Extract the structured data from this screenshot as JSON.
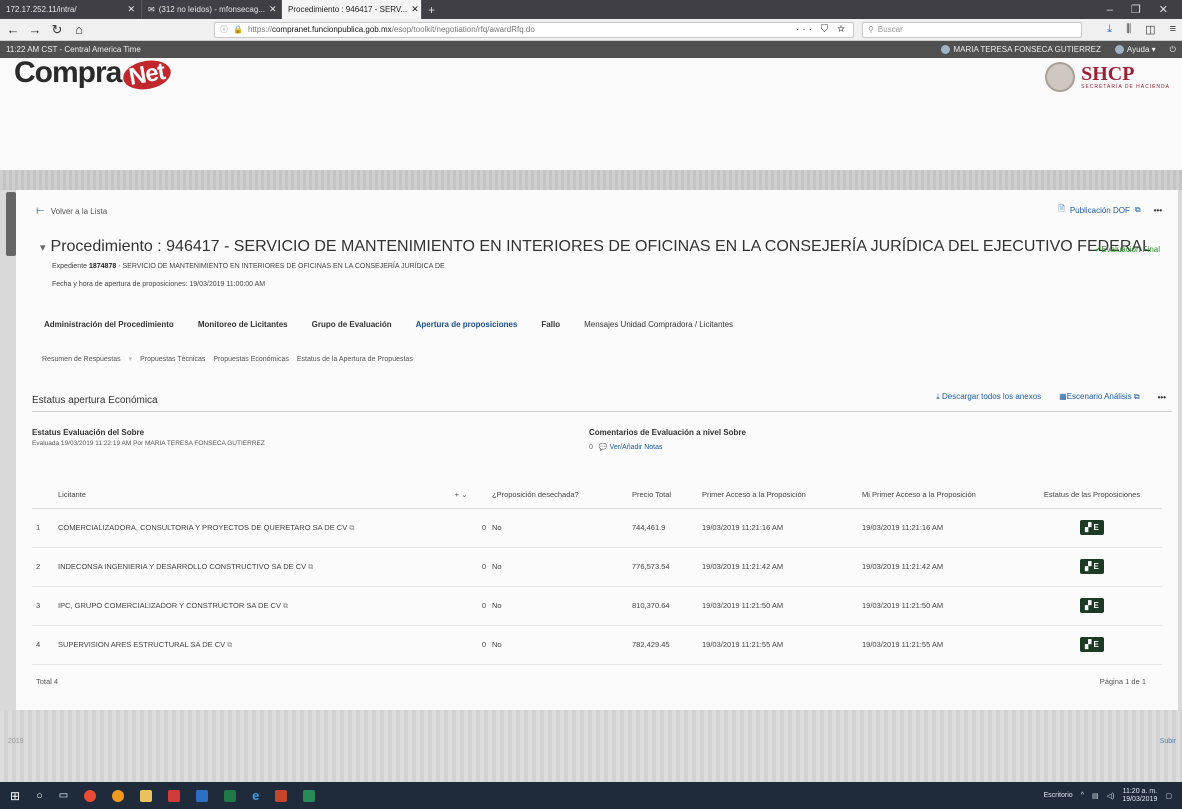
{
  "browser": {
    "tabs": [
      {
        "label": "172.17.252.11/intra/",
        "active": false
      },
      {
        "label": "(312 no leídos) - mfonsecag...",
        "active": false
      },
      {
        "label": "Procedimiento : 946417 - SERV...",
        "active": true
      }
    ],
    "url_scheme": "https://",
    "url_host": "compranet.funcionpublica.gob.mx",
    "url_path": "/esop/toolkit/negotiation/rfq/awardRfq.do",
    "search_placeholder": "Buscar"
  },
  "appbar": {
    "timezone": "11:22 AM CST - Central America Time",
    "user": "MARIA TERESA FONSECA GUTIERREZ",
    "help": "Ayuda"
  },
  "brand": {
    "logo_part1": "Compra",
    "logo_part2": "Net",
    "agency": "SHCP",
    "agency_sub": "SECRETARÍA DE HACIENDA"
  },
  "page": {
    "back_label": "Volver a la Lista",
    "dof_label": "Publicación DOF",
    "title": "Procedimiento : 946417 - SERVICIO DE MANTENIMIENTO EN INTERIORES DE OFICINAS EN LA CONSEJERÍA JURÍDICA DEL EJECUTIVO FEDERAL",
    "status": "Evaluación Final",
    "expediente_label": "Expediente",
    "expediente_num": "1874878",
    "expediente_desc": "- SERVICIO DE MANTENIMIENTO EN INTERIORES DE OFICINAS EN LA CONSEJERÍA JURÍDICA DE",
    "fecha": "Fecha y hora de apertura de proposiciones: 19/03/2019 11:00:00 AM"
  },
  "tabs": [
    {
      "label": "Administración del Procedimiento",
      "selected": false
    },
    {
      "label": "Monitoreo de Licitantes",
      "selected": false
    },
    {
      "label": "Grupo de Evaluación",
      "selected": false
    },
    {
      "label": "Apertura de proposiciones",
      "selected": true
    },
    {
      "label": "Fallo",
      "selected": false
    },
    {
      "label": "Mensajes Unidad Compradora / Licitantes",
      "selected": false
    }
  ],
  "subtabs": [
    {
      "label": "Resumen de Respuestas"
    },
    {
      "label": "Propuestas Técnicas"
    },
    {
      "label": "Propuestas Económicas"
    },
    {
      "label": "Estatus de la Apertura de Propuestas"
    }
  ],
  "section": {
    "title": "Estatus apertura Económica",
    "download_label": "Descargar todos los anexos",
    "analysis_label": "Escenario Análisis"
  },
  "evaluation": {
    "heading": "Estatus Evaluación del Sobre",
    "detail": "Evaluada 19/03/2019 11:22:19 AM Por MARIA TERESA FONSECA GUTIERREZ",
    "comments_heading": "Comentarios de Evaluación a nivel Sobre",
    "notes_count": "0",
    "notes_label": "Ver/Añadir Notas"
  },
  "table": {
    "headers": {
      "licitante": "Licitante",
      "rejected": "¿Proposición desechada?",
      "price": "Precio Total",
      "first_access": "Primer Acceso a la Proposición",
      "my_first_access": "Mi Primer Acceso a la Proposición",
      "status": "Estatus de las Proposiciones"
    },
    "rows": [
      {
        "n": "1",
        "name": "COMERCIALIZADORA, CONSULTORIA Y PROYECTOS DE QUERETARO SA DE CV",
        "count": "0",
        "rejected": "No",
        "price": "744,461.9",
        "first": "19/03/2019 11:21:16 AM",
        "mine": "19/03/2019 11:21:16 AM",
        "status": "E"
      },
      {
        "n": "2",
        "name": "INDECONSA INGENIERIA Y DESARROLLO CONSTRUCTIVO SA DE CV",
        "count": "0",
        "rejected": "No",
        "price": "776,573.54",
        "first": "19/03/2019 11:21:42 AM",
        "mine": "19/03/2019 11:21:42 AM",
        "status": "E"
      },
      {
        "n": "3",
        "name": "IPC, GRUPO COMERCIALIZADOR Y CONSTRUCTOR SA DE CV",
        "count": "0",
        "rejected": "No",
        "price": "810,370.64",
        "first": "19/03/2019 11:21:50 AM",
        "mine": "19/03/2019 11:21:50 AM",
        "status": "E"
      },
      {
        "n": "4",
        "name": "SUPERVISION ARES ESTRUCTURAL SA DE CV",
        "count": "0",
        "rejected": "No",
        "price": "782,429.45",
        "first": "19/03/2019 11:21:55 AM",
        "mine": "19/03/2019 11:21:55 AM",
        "status": "E"
      }
    ],
    "total": "Total 4",
    "pager": "Página 1 de 1"
  },
  "footer": {
    "left": "2019",
    "right": "Subir"
  },
  "taskbar": {
    "desktop_label": "Escritorio",
    "time": "11:20 a. m.",
    "date": "19/03/2019"
  },
  "colors": {
    "accent": "#1a4f8f",
    "brand_red": "#c0282d",
    "status_btn": "#1d3a25",
    "ok_green": "#2e8b2e"
  }
}
